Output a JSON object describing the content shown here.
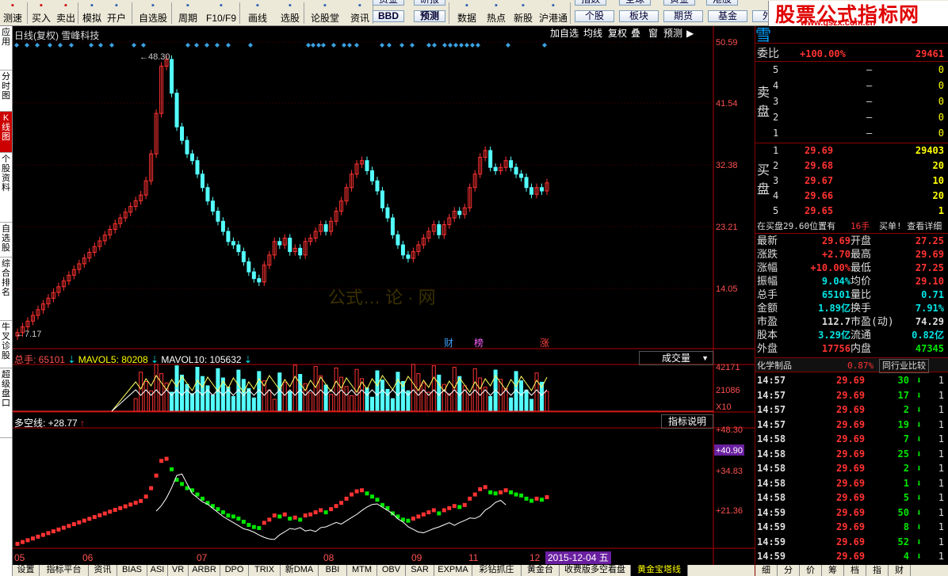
{
  "toolbar": {
    "buttons": [
      {
        "label": "测速",
        "icon": "gauge-icon"
      },
      {
        "label": "买入",
        "icon": "buy-icon"
      },
      {
        "label": "卖出",
        "icon": "sell-icon"
      },
      {
        "label": "模拟",
        "icon": "simulate-icon"
      },
      {
        "label": "开户",
        "icon": "account-icon"
      },
      {
        "label": "自选股",
        "icon": "star-icon"
      },
      {
        "label": "周期",
        "icon": "period-icon"
      },
      {
        "label": "F10/F9",
        "icon": "f10-icon"
      },
      {
        "label": "画线",
        "icon": "pen-icon"
      },
      {
        "label": "选股",
        "icon": "filter-icon"
      },
      {
        "label": "论股堂",
        "icon": "forum-icon"
      },
      {
        "label": "资讯",
        "icon": "news-icon"
      },
      {
        "label": "数据",
        "icon": "data-icon"
      },
      {
        "label": "热点",
        "icon": "hot-icon"
      },
      {
        "label": "新股",
        "icon": "new-stock-icon"
      },
      {
        "label": "沪港通",
        "icon": "hkex-icon"
      }
    ],
    "mid_buttons": [
      "BBD",
      "预测"
    ],
    "right_buttons": [
      "个股",
      "板块",
      "期货",
      "基金",
      "外汇"
    ],
    "top_cut_labels": [
      "资金",
      "研报",
      "指数",
      "全球",
      "黄金",
      "港股"
    ]
  },
  "brand": {
    "title": "股票公式指标网",
    "url": "www.gszx.com.cn"
  },
  "left_nav": [
    "应用",
    "分时图",
    "K线图",
    "个股资料",
    "自选股",
    "综合排名",
    "牛叉诊股",
    "超级盘口"
  ],
  "chart": {
    "title": "日线(复权)  雪峰科技",
    "top_buttons": [
      "加自选",
      "均线",
      "复权",
      "叠",
      "窗",
      "预测",
      "▶"
    ],
    "high_label": "48.30",
    "low_label": "7.17",
    "price_axis": [
      "50.59",
      "41.54",
      "32.38",
      "23.21",
      "14.05"
    ],
    "event_markers": [
      "财",
      "榜",
      "涨"
    ],
    "watermark": "公式… 论 · 网"
  },
  "volume": {
    "title": "总手: 65101",
    "mavol5_label": "MAVOL5: 80208",
    "mavol10_label": "MAVOL10: 105632",
    "dropdown": "成交量",
    "axis": [
      "42171",
      "21086",
      "X10"
    ]
  },
  "indicator": {
    "title": "多空线: +28.77",
    "button": "指标说明",
    "axis": [
      "+48.30",
      "+40.90",
      "+34.83",
      "+21.36"
    ]
  },
  "dates": [
    "05",
    "06",
    "07",
    "08",
    "09",
    "11",
    "12"
  ],
  "date_cursor": "2015-12-04 五",
  "bottom_tabs": [
    "设置",
    "指标平台",
    "资讯",
    "BIAS",
    "ASI",
    "VR",
    "ARBR",
    "DPO",
    "TRIX",
    "新DMA",
    "BBI",
    "MTM",
    "OBV",
    "SAR",
    "EXPMA",
    "彩钻抓庄",
    "黄金台",
    "收费版多空看盘",
    "黄金宝塔线"
  ],
  "right_panel": {
    "header_char": "雪",
    "weibi_label": "委比",
    "weibi_value": "+100.00%",
    "weibi_diff": "29461",
    "sell_label": "卖盘",
    "buy_label": "买盘",
    "sell": [
      {
        "n": "5",
        "p": "–",
        "v": "0"
      },
      {
        "n": "4",
        "p": "–",
        "v": "0"
      },
      {
        "n": "3",
        "p": "–",
        "v": "0"
      },
      {
        "n": "2",
        "p": "–",
        "v": "0"
      },
      {
        "n": "1",
        "p": "–",
        "v": "0"
      }
    ],
    "buy": [
      {
        "n": "1",
        "p": "29.69",
        "v": "29403"
      },
      {
        "n": "2",
        "p": "29.68",
        "v": "20"
      },
      {
        "n": "3",
        "p": "29.67",
        "v": "10"
      },
      {
        "n": "4",
        "p": "29.66",
        "v": "20"
      },
      {
        "n": "5",
        "p": "29.65",
        "v": "1"
      }
    ],
    "notice": "在买盘29.60位置有",
    "notice_vol": "16手",
    "notice_link": "买单! 查看详细",
    "quote": [
      [
        "最新",
        "29.69",
        "开盘",
        "27.25"
      ],
      [
        "涨跌",
        "+2.70",
        "最高",
        "29.69"
      ],
      [
        "涨幅",
        "+10.00%",
        "最低",
        "27.25"
      ],
      [
        "振幅",
        "9.04%",
        "均价",
        "29.10"
      ],
      [
        "总手",
        "65101",
        "量比",
        "0.71"
      ],
      [
        "金额",
        "1.89亿",
        "换手",
        "7.91%"
      ],
      [
        "市盈",
        "112.7",
        "市盈(动)",
        "74.29"
      ],
      [
        "股本",
        "3.29亿",
        "流通",
        "0.82亿"
      ],
      [
        "外盘",
        "17756",
        "内盘",
        "47345"
      ]
    ],
    "sector": "化学制品",
    "sector_pct": "0.87%",
    "sector_btn": "同行业比较",
    "ticks": [
      [
        "14:57",
        "29.69",
        "30"
      ],
      [
        "14:57",
        "29.69",
        "17"
      ],
      [
        "14:57",
        "29.69",
        "2"
      ],
      [
        "14:57",
        "29.69",
        "19"
      ],
      [
        "14:58",
        "29.69",
        "7"
      ],
      [
        "14:58",
        "29.69",
        "25"
      ],
      [
        "14:58",
        "29.69",
        "2"
      ],
      [
        "14:58",
        "29.69",
        "1"
      ],
      [
        "14:58",
        "29.69",
        "5"
      ],
      [
        "14:59",
        "29.69",
        "50"
      ],
      [
        "14:59",
        "29.69",
        "8"
      ],
      [
        "14:59",
        "29.69",
        "52"
      ],
      [
        "14:59",
        "29.69",
        "4"
      ]
    ],
    "bottom_tabs": [
      "细",
      "分",
      "价",
      "筹",
      "档",
      "指",
      "财"
    ]
  }
}
